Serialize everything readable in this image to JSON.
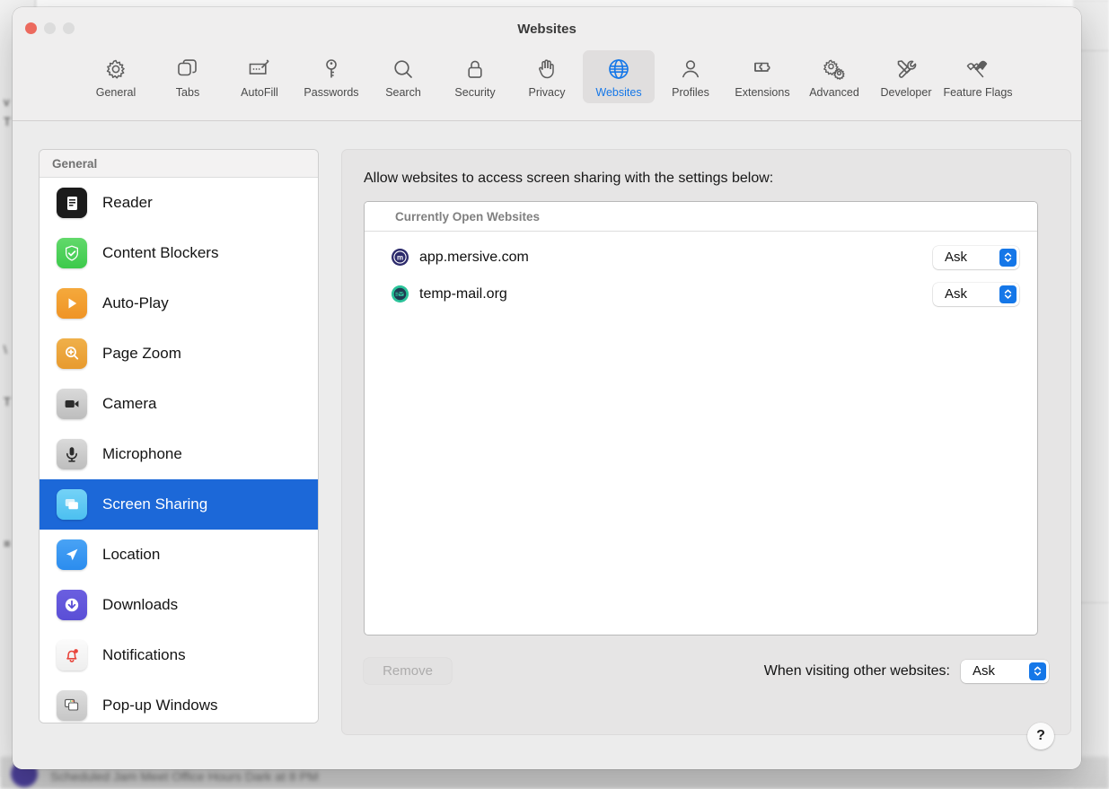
{
  "window": {
    "title": "Websites",
    "traffic_lights": [
      "close-button",
      "minimize-button",
      "zoom-button"
    ]
  },
  "toolbar": {
    "items": [
      {
        "label": "General",
        "icon": "gear-icon",
        "selected": false
      },
      {
        "label": "Tabs",
        "icon": "tabs-icon",
        "selected": false
      },
      {
        "label": "AutoFill",
        "icon": "autofill-icon",
        "selected": false
      },
      {
        "label": "Passwords",
        "icon": "key-icon",
        "selected": false
      },
      {
        "label": "Search",
        "icon": "search-icon",
        "selected": false
      },
      {
        "label": "Security",
        "icon": "lock-icon",
        "selected": false
      },
      {
        "label": "Privacy",
        "icon": "hand-icon",
        "selected": false
      },
      {
        "label": "Websites",
        "icon": "globe-icon",
        "selected": true
      },
      {
        "label": "Profiles",
        "icon": "person-icon",
        "selected": false
      },
      {
        "label": "Extensions",
        "icon": "puzzle-icon",
        "selected": false
      },
      {
        "label": "Advanced",
        "icon": "gears-icon",
        "selected": false
      },
      {
        "label": "Developer",
        "icon": "tools-icon",
        "selected": false
      },
      {
        "label": "Feature Flags",
        "icon": "flags-icon",
        "selected": false
      }
    ]
  },
  "sidebar": {
    "header": "General",
    "items": [
      {
        "label": "Reader",
        "icon": "reader-icon",
        "selected": false
      },
      {
        "label": "Content Blockers",
        "icon": "shield-check-icon",
        "selected": false
      },
      {
        "label": "Auto-Play",
        "icon": "play-icon",
        "selected": false
      },
      {
        "label": "Page Zoom",
        "icon": "zoom-in-icon",
        "selected": false
      },
      {
        "label": "Camera",
        "icon": "camera-icon",
        "selected": false
      },
      {
        "label": "Microphone",
        "icon": "microphone-icon",
        "selected": false
      },
      {
        "label": "Screen Sharing",
        "icon": "screen-sharing-icon",
        "selected": true
      },
      {
        "label": "Location",
        "icon": "location-arrow-icon",
        "selected": false
      },
      {
        "label": "Downloads",
        "icon": "download-icon",
        "selected": false
      },
      {
        "label": "Notifications",
        "icon": "bell-icon",
        "selected": false
      },
      {
        "label": "Pop-up Windows",
        "icon": "popup-windows-icon",
        "selected": false
      }
    ]
  },
  "content": {
    "title": "Allow websites to access screen sharing with the settings below:",
    "list_header": "Currently Open Websites",
    "rows": [
      {
        "site": "app.mersive.com",
        "favicon": "mersive-favicon",
        "permission": "Ask"
      },
      {
        "site": "temp-mail.org",
        "favicon": "temp-mail-favicon",
        "permission": "Ask"
      }
    ],
    "remove_label": "Remove",
    "other_websites_label": "When visiting other websites:",
    "other_websites_value": "Ask",
    "help_label": "?"
  },
  "background": {
    "left_text": [
      "v",
      "T",
      "\\",
      "T",
      "≡"
    ],
    "bottom_text": "Scheduled Jam Meet Office Hours Dark at 8 PM"
  },
  "colors": {
    "accent_blue": "#1577e8",
    "selection_blue": "#1c68d8",
    "window_bg": "#ececec",
    "panel_bg": "#e6e5e5",
    "close_red": "#ec6a5e"
  }
}
